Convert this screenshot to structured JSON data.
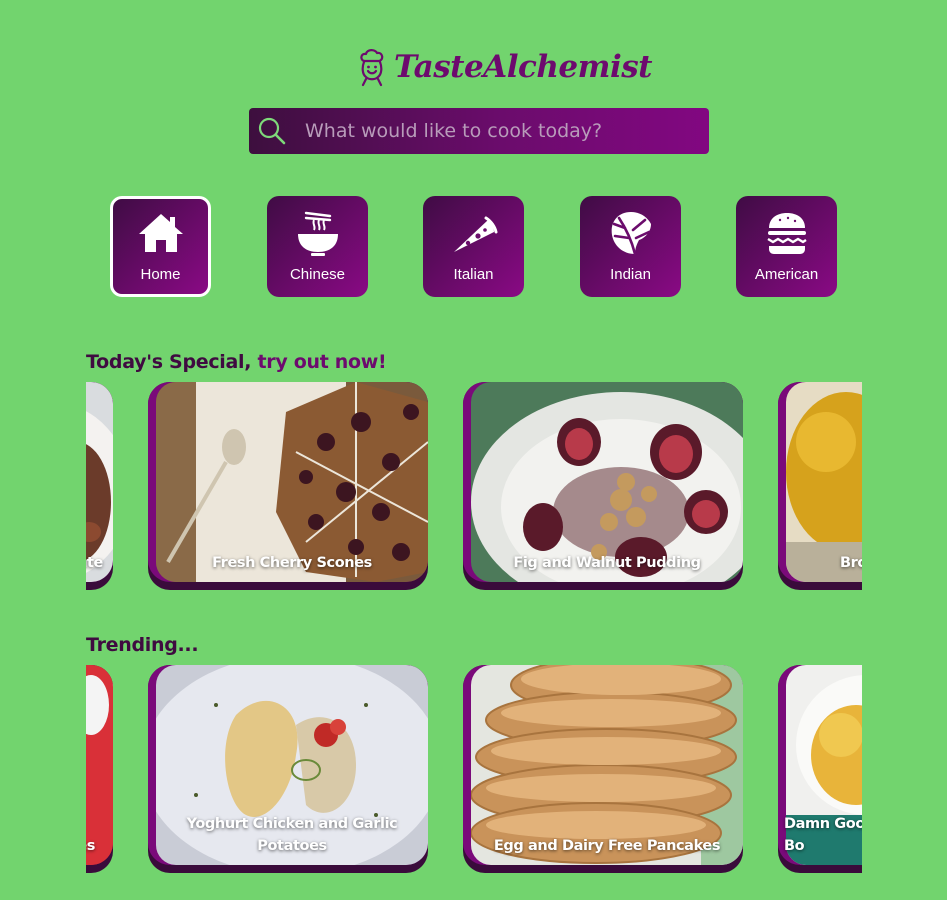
{
  "app": {
    "name": "TasteAlchemist"
  },
  "search": {
    "placeholder": "What would like to cook today?"
  },
  "categories": [
    {
      "label": "Home",
      "icon": "home-icon",
      "active": true
    },
    {
      "label": "Chinese",
      "icon": "noodle-bowl-icon",
      "active": false
    },
    {
      "label": "Italian",
      "icon": "pizza-slice-icon",
      "active": false
    },
    {
      "label": "Indian",
      "icon": "monstera-leaf-icon",
      "active": false
    },
    {
      "label": "American",
      "icon": "burger-icon",
      "active": false
    }
  ],
  "sections": {
    "special": {
      "title_main": "Today's Special, ",
      "title_accent": "try out now!",
      "cards": [
        {
          "title": "ate",
          "partial": true
        },
        {
          "title": "Fresh Cherry Scones"
        },
        {
          "title": "Fig and Walnut Pudding"
        },
        {
          "title": "Brow",
          "partial": true
        }
      ]
    },
    "trending": {
      "title": "Trending...",
      "cards": [
        {
          "title": "es",
          "partial": true
        },
        {
          "title": "Yoghurt Chicken and Garlic Potatoes"
        },
        {
          "title": "Egg and Dairy Free Pancakes"
        },
        {
          "title": "Damn Goo Bo",
          "partial": true
        }
      ]
    }
  },
  "colors": {
    "background": "#72d46e",
    "brand": "#6d0a6e",
    "dark_purple": "#3f0b40"
  }
}
